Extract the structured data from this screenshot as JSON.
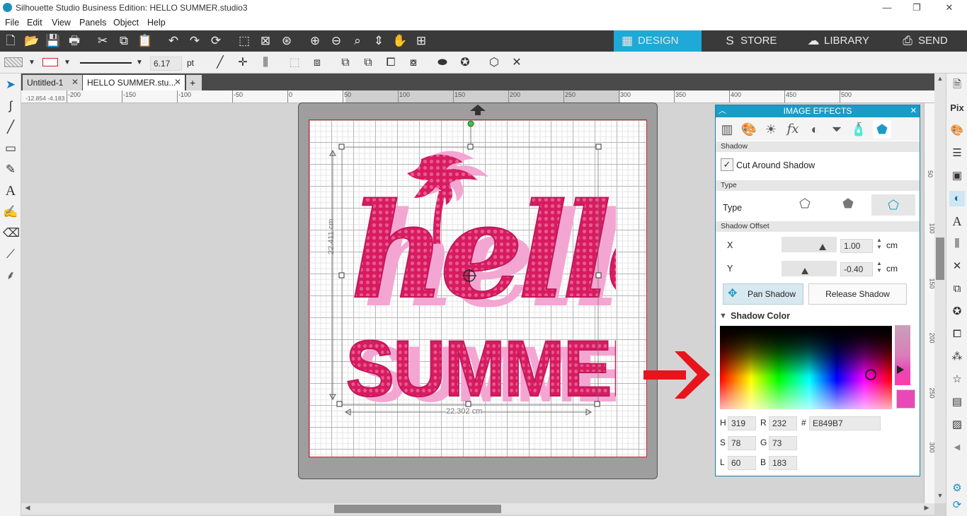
{
  "window": {
    "title": "Silhouette Studio Business Edition: HELLO SUMMER.studio3"
  },
  "menu": [
    "File",
    "Edit",
    "View",
    "Panels",
    "Object",
    "Help"
  ],
  "nav_tabs": [
    {
      "label": "DESIGN",
      "icon": "grid-icon",
      "active": true
    },
    {
      "label": "STORE",
      "icon": "store-icon",
      "active": false
    },
    {
      "label": "LIBRARY",
      "icon": "cloud-icon",
      "active": false
    },
    {
      "label": "SEND",
      "icon": "send-icon",
      "active": false
    }
  ],
  "toolbar2": {
    "line_width": "6.17",
    "line_unit": "pt"
  },
  "doc_tabs": [
    {
      "label": "Untitled-1",
      "active": false
    },
    {
      "label": "HELLO SUMMER.stu...",
      "active": true
    }
  ],
  "ruler": {
    "coords": "-12.854 -4.183",
    "h_ticks": [
      "-200",
      "-150",
      "-100",
      "-50",
      "0",
      "50",
      "100",
      "150",
      "200",
      "250",
      "300",
      "350",
      "400",
      "450",
      "500"
    ],
    "v_ticks": [
      "50",
      "100",
      "150",
      "200",
      "250",
      "300"
    ]
  },
  "selection": {
    "width_label": "22.302 cm",
    "height_label": "22.411 cm"
  },
  "artwork": {
    "line1": "hello",
    "line2": "SUMMER"
  },
  "image_effects": {
    "title": "IMAGE EFFECTS",
    "sections": {
      "shadow": "Shadow",
      "type": "Type",
      "offset": "Shadow Offset"
    },
    "cut_around_shadow": {
      "label": "Cut Around Shadow",
      "checked": true
    },
    "type_label": "Type",
    "offset": {
      "x_label": "X",
      "x_value": "1.00",
      "x_unit": "cm",
      "y_label": "Y",
      "y_value": "-0.40",
      "y_unit": "cm"
    },
    "pan_shadow": "Pan Shadow",
    "release_shadow": "Release Shadow",
    "shadow_color_label": "Shadow Color",
    "color": {
      "h_label": "H",
      "h": "319",
      "r_label": "R",
      "r": "232",
      "hash_label": "#",
      "hex": "E849B7",
      "s_label": "S",
      "s": "78",
      "g_label": "G",
      "g": "73",
      "l_label": "L",
      "l": "60",
      "b_label": "B",
      "b": "183",
      "swatch": "#E849B7"
    }
  },
  "colors": {
    "accent": "#1b9bc7",
    "artwork": "#d81b60",
    "shadow": "#f48fc8",
    "arrow": "#e8141b"
  }
}
